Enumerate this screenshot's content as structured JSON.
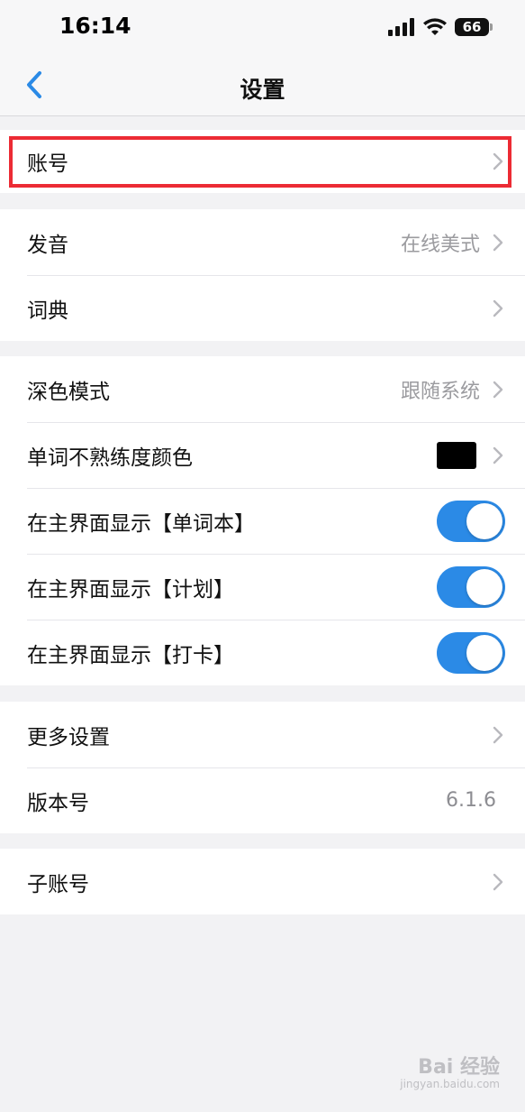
{
  "status_bar": {
    "time": "16:14",
    "battery": "66"
  },
  "nav": {
    "title": "设置"
  },
  "groups": [
    {
      "rows": [
        {
          "label": "账号"
        }
      ]
    },
    {
      "rows": [
        {
          "label": "发音",
          "value": "在线美式"
        },
        {
          "label": "词典"
        }
      ]
    },
    {
      "rows": [
        {
          "label": "深色模式",
          "value": "跟随系统"
        },
        {
          "label": "单词不熟练度颜色",
          "swatch_color": "#000000"
        },
        {
          "label": "在主界面显示【单词本】",
          "toggle_on": true
        },
        {
          "label": "在主界面显示【计划】",
          "toggle_on": true
        },
        {
          "label": "在主界面显示【打卡】",
          "toggle_on": true
        }
      ]
    },
    {
      "rows": [
        {
          "label": "更多设置"
        },
        {
          "label": "版本号",
          "value": "6.1.6"
        }
      ]
    },
    {
      "rows": [
        {
          "label": "子账号"
        }
      ]
    }
  ],
  "colors": {
    "accent": "#2b8ae6",
    "highlight": "#ec2b34",
    "background": "#f2f2f4"
  },
  "watermark": {
    "text": "Bai 经验",
    "sub": "jingyan.baidu.com"
  }
}
